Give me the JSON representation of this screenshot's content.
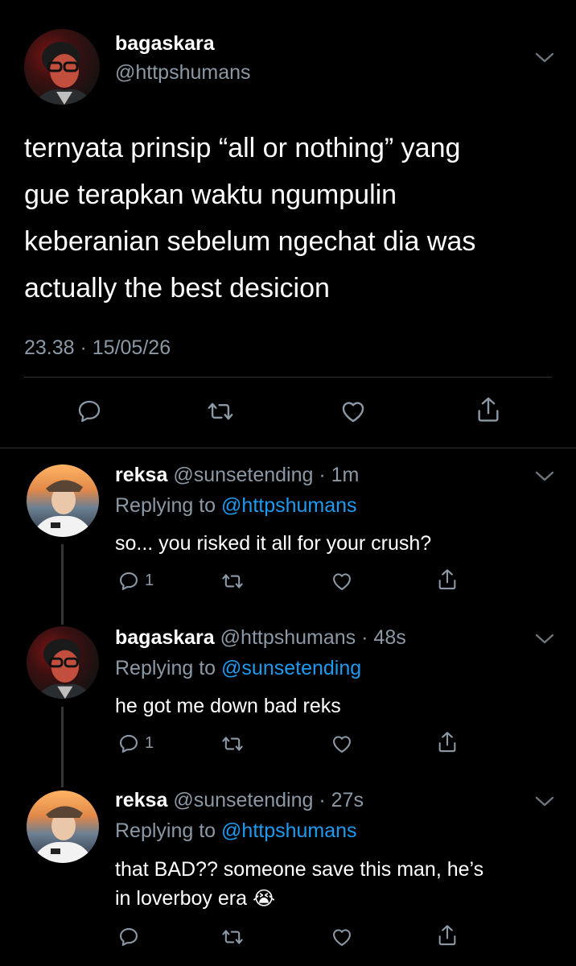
{
  "main_tweet": {
    "display_name": "bagaskara",
    "handle": "@httpshumans",
    "text_lines": [
      "ternyata prinsip “all or nothing” yang",
      "gue terapkan waktu ngumpulin",
      "keberanian sebelum ngechat dia was",
      "actually the best desicion"
    ],
    "timestamp": "23.38 · 15/05/26"
  },
  "replies": [
    {
      "display_name": "reksa",
      "handle": "@sunsetending",
      "time": "· 1m",
      "replying_label": "Replying to",
      "replying_to": "@httpshumans",
      "text_lines": [
        "so... you risked it all for your crush?"
      ],
      "reply_count": "1"
    },
    {
      "display_name": "bagaskara",
      "handle": "@httpshumans",
      "time": "· 48s",
      "replying_label": "Replying to",
      "replying_to": "@sunsetending",
      "text_lines": [
        "he got me down bad reks"
      ],
      "reply_count": "1"
    },
    {
      "display_name": "reksa",
      "handle": "@sunsetending",
      "time": "· 27s",
      "replying_label": "Replying to",
      "replying_to": "@httpshumans",
      "text_lines": [
        "that BAD?? someone save this man, he’s",
        "in loverboy era"
      ],
      "emoji": "😭",
      "reply_count": ""
    }
  ],
  "icons": {
    "reply": "speech-bubble-icon",
    "retweet": "retweet-arrows-icon",
    "like": "heart-outline-icon",
    "share": "share-upload-icon",
    "more": "chevron-down-icon"
  },
  "colors": {
    "background": "#000000",
    "text": "#ffffff",
    "muted": "#8b98a5",
    "link": "#1d9bf0"
  }
}
